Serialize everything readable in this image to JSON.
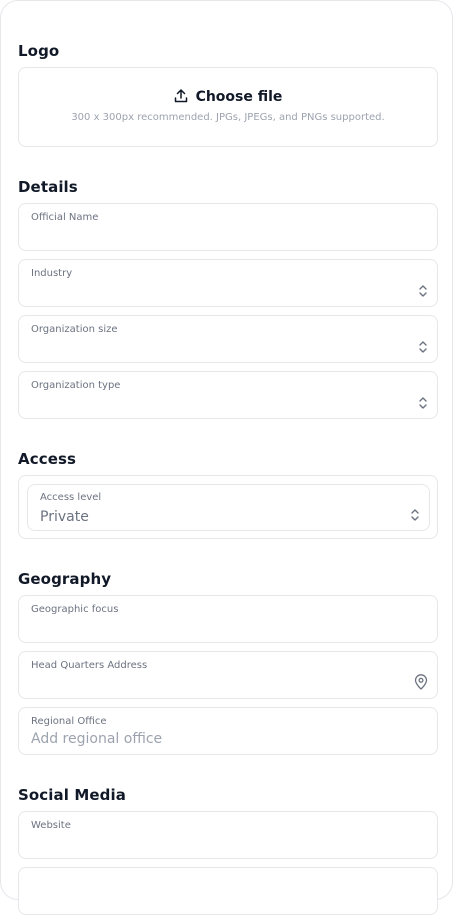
{
  "logo": {
    "title": "Logo",
    "choose_label": "Choose file",
    "hint": "300 x 300px recommended. JPGs, JPEGs, and PNGs supported."
  },
  "details": {
    "title": "Details",
    "official_name": "Official Name",
    "industry": "Industry",
    "org_size": "Organization size",
    "org_type": "Organization type"
  },
  "access": {
    "title": "Access",
    "level_label": "Access level",
    "level_value": "Private"
  },
  "geography": {
    "title": "Geography",
    "focus_label": "Geographic focus",
    "hq_label": "Head Quarters Address",
    "regional_label": "Regional Office",
    "regional_placeholder": "Add regional office"
  },
  "social": {
    "title": "Social Media",
    "website_label": "Website"
  },
  "icons": {
    "upload": "upload-icon",
    "chevron": "chevron-up-down-icon",
    "location": "map-pin-icon"
  }
}
